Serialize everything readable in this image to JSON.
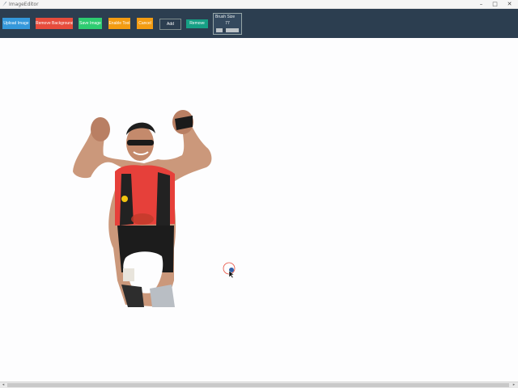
{
  "window": {
    "title": "ImageEditor",
    "minimize_glyph": "–",
    "maximize_glyph": "□",
    "close_glyph": "✕"
  },
  "toolbar": {
    "upload_label": "Upload Image",
    "remove_bg_label": "Remove Background",
    "save_label": "Save Image",
    "enable_tool_label": "Enable Tool",
    "cancel_label": "Cancel",
    "add_label": "Add",
    "remove_label": "Remove",
    "colors": {
      "background": "#2c3e50",
      "upload": "#3498db",
      "remove_bg": "#e74c3c",
      "save": "#2ecc71",
      "enable_tool": "#f39c12",
      "cancel": "#f39c12",
      "remove": "#16a085"
    }
  },
  "brush": {
    "label": "Brush Size",
    "value": "77",
    "slider_fraction": 0.35
  },
  "canvas": {
    "image_icon": "person-cutout-icon",
    "cursor_icon": "brush-cursor-icon"
  },
  "scrollbar": {
    "left_arrow": "◂",
    "right_arrow": "▸"
  }
}
